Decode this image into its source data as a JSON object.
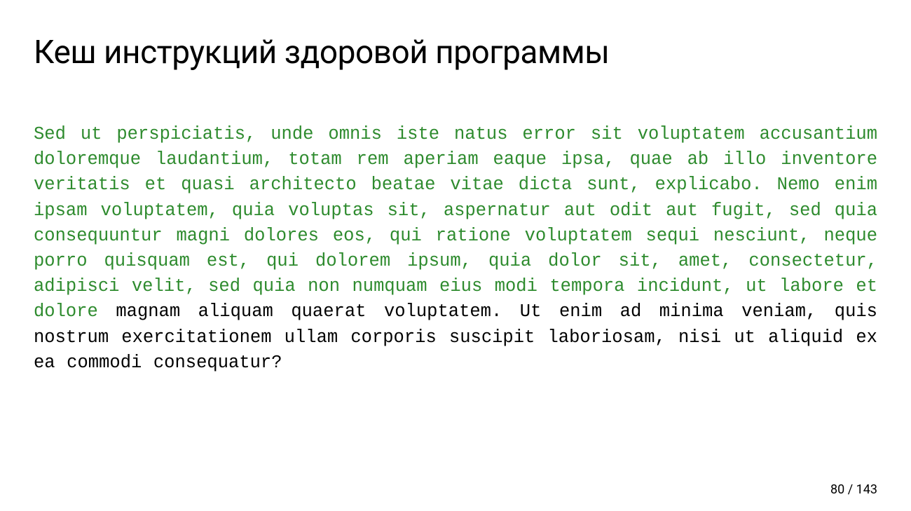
{
  "slide": {
    "title": "Кеш инструкций здоровой программы",
    "body": {
      "green_part": "Sed ut perspiciatis, unde omnis iste natus error sit voluptatem accusantium doloremque laudantium, totam rem aperiam eaque ipsa, quae ab illo inventore veritatis et quasi architecto beatae vitae dicta sunt, explicabo. Nemo enim ipsam voluptatem, quia voluptas sit, aspernatur aut odit aut fugit, sed quia consequuntur magni dolores eos, qui ratione voluptatem sequi nesciunt, neque porro quisquam est, qui dolorem ipsum, quia dolor sit, amet, consectetur, adipisci velit, sed quia non numquam eius modi tempora incidunt, ut labore et dolore ",
      "black_part": "magnam aliquam quaerat voluptatem. Ut enim ad minima veniam, quis nostrum exercitationem ullam corporis suscipit laboriosam, nisi ut aliquid ex ea commodi consequatur?"
    },
    "page": {
      "current": "80",
      "separator": " / ",
      "total": "143"
    }
  }
}
